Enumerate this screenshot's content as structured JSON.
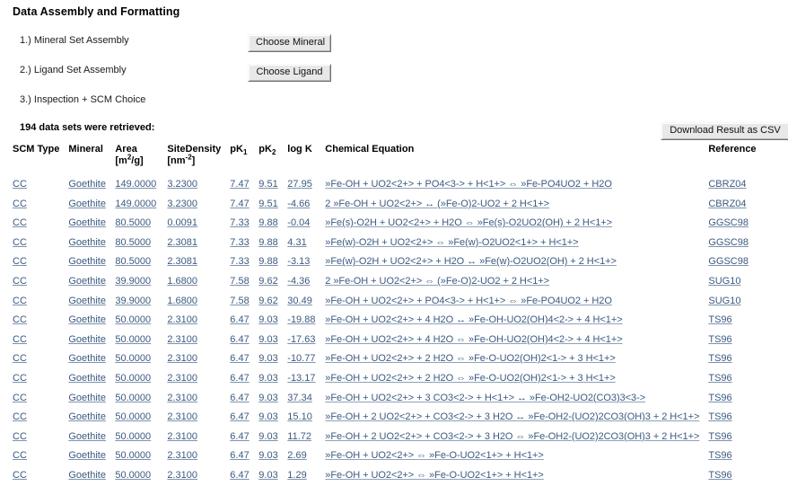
{
  "page": {
    "title": "Data Assembly and Formatting"
  },
  "steps": [
    {
      "label": "1.) Mineral Set Assembly",
      "button": "Choose Mineral"
    },
    {
      "label": "2.) Ligand Set Assembly",
      "button": "Choose Ligand"
    },
    {
      "label": "3.) Inspection + SCM Choice",
      "button": ""
    }
  ],
  "results": {
    "retrieved_text": "194 data sets were retrieved:",
    "download_button": "Download Result as CSV",
    "columns": {
      "scm_type": "SCM Type",
      "mineral": "Mineral",
      "area": "Area",
      "area_units_prefix": "[m",
      "area_units_sup": "2",
      "area_units_suffix": "/g]",
      "site_density": "SiteDensity",
      "site_units_prefix": "[nm",
      "site_units_sup": "-2",
      "site_units_suffix": "]",
      "pk1": "pK",
      "pk1_sub": "1",
      "pk2": "pK",
      "pk2_sub": "2",
      "log_k": "log K",
      "chemical_equation": "Chemical Equation",
      "reference": "Reference"
    },
    "rows": [
      {
        "scm_type": "CC",
        "mineral": "Goethite",
        "area": "149.0000",
        "site_density": "3.2300",
        "pk1": "7.47",
        "pk2": "9.51",
        "log_k": "27.95",
        "equation": "»Fe-OH + UO2<2+> + PO4<3-> + H<1+>  ⇔  »Fe-PO4UO2 + H2O",
        "reference": "CBRZ04"
      },
      {
        "scm_type": "CC",
        "mineral": "Goethite",
        "area": "149.0000",
        "site_density": "3.2300",
        "pk1": "7.47",
        "pk2": "9.51",
        "log_k": "-4.66",
        "equation": "2 »Fe-OH + UO2<2+>  ↔  (»Fe-O)2-UO2 + 2 H<1+>",
        "reference": "CBRZ04"
      },
      {
        "scm_type": "CC",
        "mineral": "Goethite",
        "area": "80.5000",
        "site_density": "0.0091",
        "pk1": "7.33",
        "pk2": "9.88",
        "log_k": "-0.04",
        "equation": "»Fe(s)-O2H + UO2<2+> + H2O  ⇔  »Fe(s)-O2UO2(OH) + 2 H<1+>",
        "reference": "GGSC98"
      },
      {
        "scm_type": "CC",
        "mineral": "Goethite",
        "area": "80.5000",
        "site_density": "2.3081",
        "pk1": "7.33",
        "pk2": "9.88",
        "log_k": "4.31",
        "equation": "»Fe(w)-O2H + UO2<2+>  ⇔  »Fe(w)-O2UO2<1+> + H<1+>",
        "reference": "GGSC98"
      },
      {
        "scm_type": "CC",
        "mineral": "Goethite",
        "area": "80.5000",
        "site_density": "2.3081",
        "pk1": "7.33",
        "pk2": "9.88",
        "log_k": "-3.13",
        "equation": "»Fe(w)-O2H + UO2<2+> + H2O  ↔  »Fe(w)-O2UO2(OH) + 2 H<1+>",
        "reference": "GGSC98"
      },
      {
        "scm_type": "CC",
        "mineral": "Goethite",
        "area": "39.9000",
        "site_density": "1.6800",
        "pk1": "7.58",
        "pk2": "9.62",
        "log_k": "-4.36",
        "equation": "2 »Fe-OH + UO2<2+>  ⇔  (»Fe-O)2-UO2 + 2 H<1+>",
        "reference": "SUG10"
      },
      {
        "scm_type": "CC",
        "mineral": "Goethite",
        "area": "39.9000",
        "site_density": "1.6800",
        "pk1": "7.58",
        "pk2": "9.62",
        "log_k": "30.49",
        "equation": "»Fe-OH + UO2<2+> + PO4<3-> + H<1+>  ⇔  »Fe-PO4UO2 + H2O",
        "reference": "SUG10"
      },
      {
        "scm_type": "CC",
        "mineral": "Goethite",
        "area": "50.0000",
        "site_density": "2.3100",
        "pk1": "6.47",
        "pk2": "9.03",
        "log_k": "-19.88",
        "equation": "»Fe-OH + UO2<2+> + 4 H2O  ↔  »Fe-OH-UO2(OH)4<2-> + 4 H<1+>",
        "reference": "TS96"
      },
      {
        "scm_type": "CC",
        "mineral": "Goethite",
        "area": "50.0000",
        "site_density": "2.3100",
        "pk1": "6.47",
        "pk2": "9.03",
        "log_k": "-17.63",
        "equation": "»Fe-OH + UO2<2+> + 4 H2O  ⇔  »Fe-OH-UO2(OH)4<2-> + 4 H<1+>",
        "reference": "TS96"
      },
      {
        "scm_type": "CC",
        "mineral": "Goethite",
        "area": "50.0000",
        "site_density": "2.3100",
        "pk1": "6.47",
        "pk2": "9.03",
        "log_k": "-10.77",
        "equation": "»Fe-OH + UO2<2+> + 2 H2O  ⇔  »Fe-O-UO2(OH)2<1-> + 3 H<1+>",
        "reference": "TS96"
      },
      {
        "scm_type": "CC",
        "mineral": "Goethite",
        "area": "50.0000",
        "site_density": "2.3100",
        "pk1": "6.47",
        "pk2": "9.03",
        "log_k": "-13.17",
        "equation": "»Fe-OH + UO2<2+> + 2 H2O  ⇔  »Fe-O-UO2(OH)2<1-> + 3 H<1+>",
        "reference": "TS96"
      },
      {
        "scm_type": "CC",
        "mineral": "Goethite",
        "area": "50.0000",
        "site_density": "2.3100",
        "pk1": "6.47",
        "pk2": "9.03",
        "log_k": "37.34",
        "equation": "»Fe-OH + UO2<2+> + 3 CO3<2-> + H<1+>  ↔  »Fe-OH2-UO2(CO3)3<3->",
        "reference": "TS96"
      },
      {
        "scm_type": "CC",
        "mineral": "Goethite",
        "area": "50.0000",
        "site_density": "2.3100",
        "pk1": "6.47",
        "pk2": "9.03",
        "log_k": "15.10",
        "equation": "»Fe-OH + 2 UO2<2+> + CO3<2-> + 3 H2O  ↔  »Fe-OH2-(UO2)2CO3(OH)3 + 2 H<1+>",
        "reference": "TS96"
      },
      {
        "scm_type": "CC",
        "mineral": "Goethite",
        "area": "50.0000",
        "site_density": "2.3100",
        "pk1": "6.47",
        "pk2": "9.03",
        "log_k": "11.72",
        "equation": "»Fe-OH + 2 UO2<2+> + CO3<2-> + 3 H2O  ⇔  »Fe-OH2-(UO2)2CO3(OH)3 + 2 H<1+>",
        "reference": "TS96"
      },
      {
        "scm_type": "CC",
        "mineral": "Goethite",
        "area": "50.0000",
        "site_density": "2.3100",
        "pk1": "6.47",
        "pk2": "9.03",
        "log_k": "2.69",
        "equation": "»Fe-OH + UO2<2+>  ⇔  »Fe-O-UO2<1+> + H<1+>",
        "reference": "TS96"
      },
      {
        "scm_type": "CC",
        "mineral": "Goethite",
        "area": "50.0000",
        "site_density": "2.3100",
        "pk1": "6.47",
        "pk2": "9.03",
        "log_k": "1.29",
        "equation": "»Fe-OH + UO2<2+>  ⇔  »Fe-O-UO2<1+> + H<1+>",
        "reference": "TS96"
      }
    ]
  },
  "colors": {
    "link": "#3c5a80",
    "text": "#1a1a1a",
    "button_face": "#e8e8e8",
    "background": "#ffffff"
  }
}
